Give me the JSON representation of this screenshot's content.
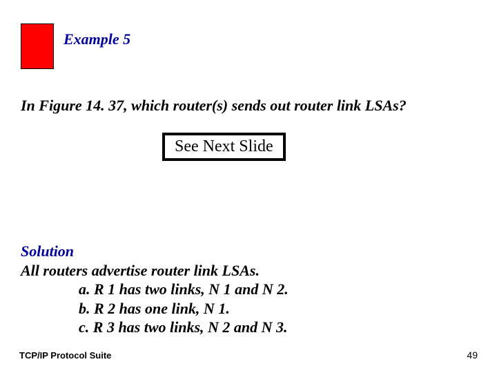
{
  "title": "Example 5",
  "question": "In Figure 14. 37, which router(s) sends out router link LSAs?",
  "next_slide": "See Next Slide",
  "solution": {
    "label": "Solution",
    "line1": "All routers advertise router link LSAs.",
    "a": "a. R 1 has two links, N 1 and N 2.",
    "b": "b. R 2 has one link, N 1.",
    "c": "c. R 3 has two links, N 2 and N 3."
  },
  "footer": {
    "left": "TCP/IP Protocol Suite",
    "page": "49"
  }
}
